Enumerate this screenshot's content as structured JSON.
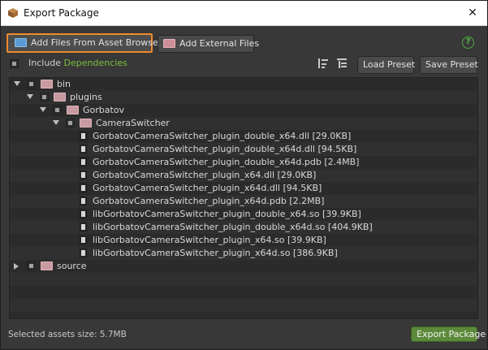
{
  "window": {
    "title": "Export Package",
    "close_glyph": "✕"
  },
  "toolbar": {
    "add_from_asset_browser": "Add Files From Asset Browser",
    "add_external": "Add External Files",
    "help_glyph": "?"
  },
  "include": {
    "prefix": "Include ",
    "link": "Dependencies"
  },
  "presets": {
    "load": "Load Preset",
    "save": "Save Preset"
  },
  "tree": [
    {
      "label": "bin",
      "type": "folder",
      "depth": 0,
      "expanded": true
    },
    {
      "label": "plugins",
      "type": "folder",
      "depth": 1,
      "expanded": true
    },
    {
      "label": "Gorbatov",
      "type": "folder",
      "depth": 2,
      "expanded": true
    },
    {
      "label": "CameraSwitcher",
      "type": "folder",
      "depth": 3,
      "expanded": true
    },
    {
      "label": "GorbatovCameraSwitcher_plugin_double_x64.dll [29.0KB]",
      "type": "file",
      "depth": 4
    },
    {
      "label": "GorbatovCameraSwitcher_plugin_double_x64d.dll [94.5KB]",
      "type": "file",
      "depth": 4
    },
    {
      "label": "GorbatovCameraSwitcher_plugin_double_x64d.pdb [2.4MB]",
      "type": "file",
      "depth": 4
    },
    {
      "label": "GorbatovCameraSwitcher_plugin_x64.dll [29.0KB]",
      "type": "file",
      "depth": 4
    },
    {
      "label": "GorbatovCameraSwitcher_plugin_x64d.dll [94.5KB]",
      "type": "file",
      "depth": 4
    },
    {
      "label": "GorbatovCameraSwitcher_plugin_x64d.pdb [2.2MB]",
      "type": "file",
      "depth": 4
    },
    {
      "label": "libGorbatovCameraSwitcher_plugin_double_x64.so [39.9KB]",
      "type": "file",
      "depth": 4
    },
    {
      "label": "libGorbatovCameraSwitcher_plugin_double_x64d.so [404.9KB]",
      "type": "file",
      "depth": 4
    },
    {
      "label": "libGorbatovCameraSwitcher_plugin_x64.so [39.9KB]",
      "type": "file",
      "depth": 4
    },
    {
      "label": "libGorbatovCameraSwitcher_plugin_x64d.so [386.9KB]",
      "type": "file",
      "depth": 4
    },
    {
      "label": "source",
      "type": "folder",
      "depth": 0,
      "expanded": false
    }
  ],
  "status": {
    "selected_size": "Selected assets size: 5.7MB"
  },
  "actions": {
    "export": "Export Package"
  },
  "colors": {
    "accent_orange": "#f08a2c",
    "dependency_green": "#7cbf3c",
    "export_green": "#5c8a3a"
  }
}
